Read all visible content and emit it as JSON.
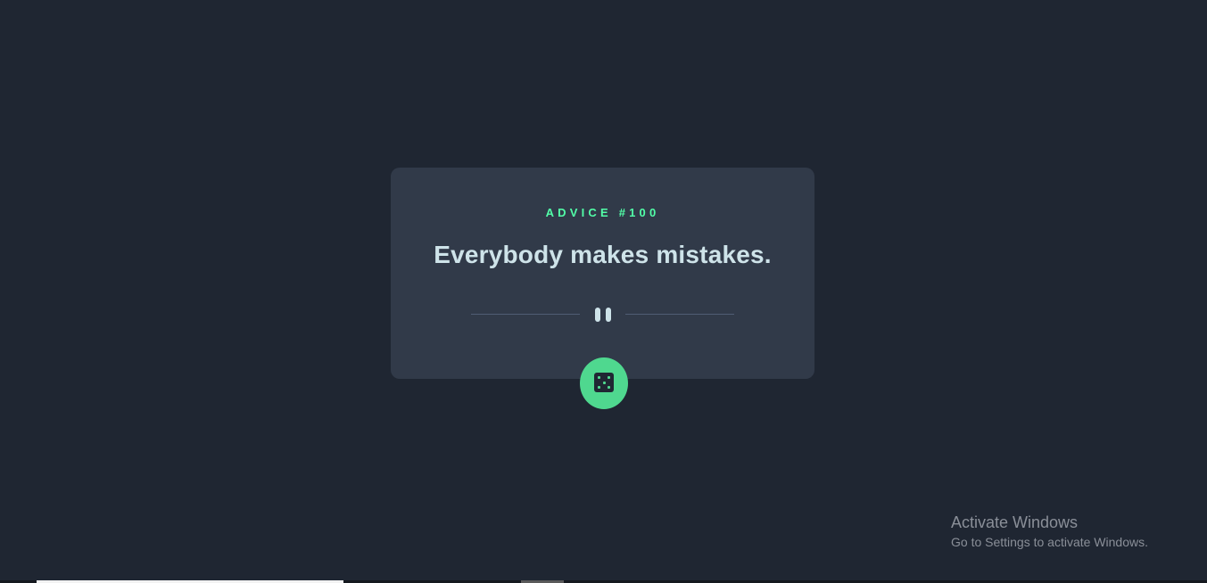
{
  "card": {
    "advice_id": "ADVICE #100",
    "advice_text": "Everybody makes mistakes."
  },
  "icons": {
    "divider": "pause-icon",
    "button": "dice-icon"
  },
  "colors": {
    "background": "#1f2632",
    "card": "#313a49",
    "accent": "#52ffa8",
    "text": "#cee3e9"
  },
  "watermark": {
    "title": "Activate Windows",
    "subtitle": "Go to Settings to activate Windows."
  }
}
